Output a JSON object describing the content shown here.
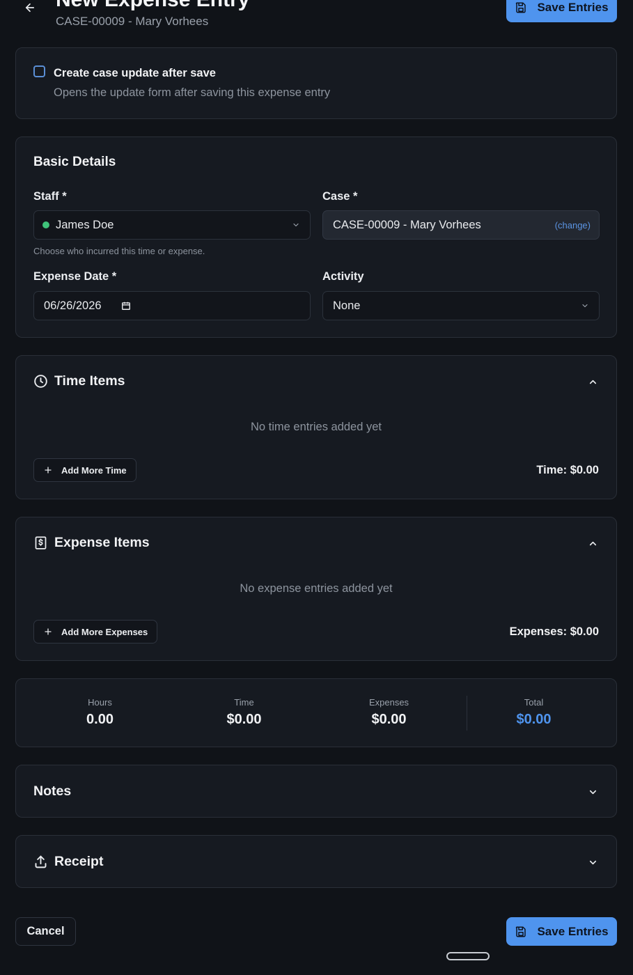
{
  "header": {
    "title": "New Expense Entry",
    "subtitle": "CASE-00009 - Mary Vorhees",
    "save_label": "Save Entries"
  },
  "toggle": {
    "title": "Create case update after save",
    "description": "Opens the update form after saving this expense entry",
    "checked": false
  },
  "basic": {
    "title": "Basic Details",
    "staff_label": "Staff *",
    "staff_value": "James Doe",
    "staff_help": "Choose who incurred this time or expense.",
    "case_label": "Case *",
    "case_value": "CASE-00009 - Mary Vorhees",
    "case_change": "(change)",
    "date_label": "Expense Date *",
    "date_value": "06/26/2026",
    "activity_label": "Activity",
    "activity_value": "None"
  },
  "time_items": {
    "title": "Time Items",
    "empty": "No time entries added yet",
    "add_label": "Add More Time",
    "total": "Time: $0.00"
  },
  "expense_items": {
    "title": "Expense Items",
    "empty": "No expense entries added yet",
    "add_label": "Add More Expenses",
    "total": "Expenses: $0.00"
  },
  "summary": {
    "hours_label": "Hours",
    "hours_value": "0.00",
    "time_label": "Time",
    "time_value": "$0.00",
    "expenses_label": "Expenses",
    "expenses_value": "$0.00",
    "total_label": "Total",
    "total_value": "$0.00"
  },
  "notes": {
    "title": "Notes"
  },
  "receipt": {
    "title": "Receipt"
  },
  "footer": {
    "cancel_label": "Cancel",
    "save_label": "Save Entries"
  },
  "colors": {
    "background": "#101318",
    "card": "#161a21",
    "accent": "#4f94ee",
    "status_dot": "#3fc27a"
  }
}
